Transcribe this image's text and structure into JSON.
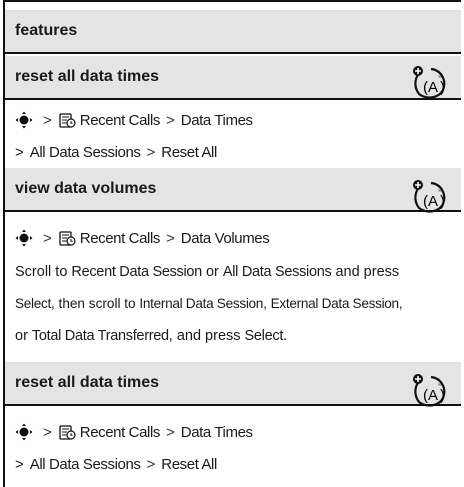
{
  "header": {
    "title": "features"
  },
  "sections": [
    {
      "heading": "reset all data times",
      "line1": {
        "item": "Recent Calls",
        "sep": ">",
        "target": "Data Times"
      },
      "line2": {
        "sep1": ">",
        "a": "All Data Sessions",
        "sep2": ">",
        "b": "Reset All"
      }
    },
    {
      "heading": "view data volumes",
      "line1": {
        "item": "Recent Calls",
        "sep": ">",
        "target": "Data Volumes"
      },
      "paragraph": {
        "p1": "Scroll to ",
        "k1": "Recent Data Session",
        "p2": " or ",
        "k2": "All Data Sessions",
        "p3": " and press",
        "k3": "Select",
        "p4": ", then scroll to ",
        "k4": "Internal Data Session",
        "p5": ", ",
        "k5": "External Data Session",
        "p6": ",",
        "p7": "or ",
        "k6": "Total Data Transferred",
        "p8": ", and press ",
        "k7": "Select",
        "p9": "."
      }
    },
    {
      "heading": "reset all data times",
      "line1": {
        "item": "Recent Calls",
        "sep": ">",
        "target": "Data Times"
      },
      "line2": {
        "sep1": ">",
        "a": "All Data Sessions",
        "sep2": ">",
        "b": "Reset All"
      }
    }
  ],
  "icons": {
    "nav": "nav-key-icon",
    "recent_calls": "recent-calls-icon",
    "network": "network-dependent-feature-icon"
  },
  "colors": {
    "header_bg": "#e4e4e4",
    "rule": "#111111"
  }
}
